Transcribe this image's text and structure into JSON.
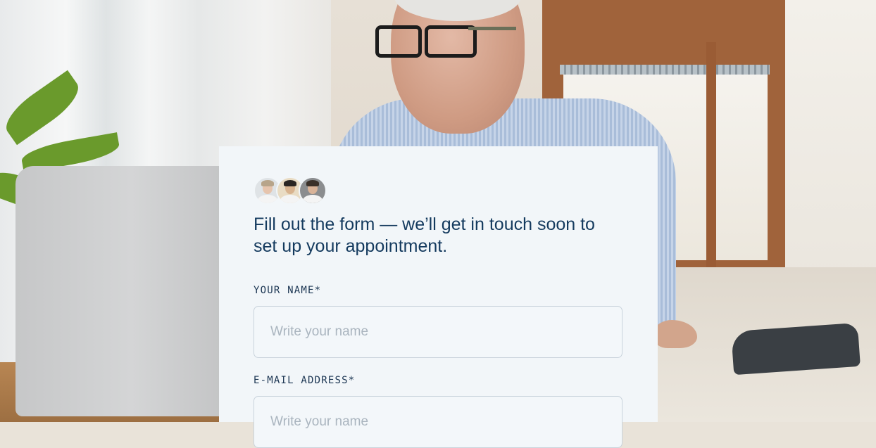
{
  "form": {
    "headline": "Fill out the form — we’ll get in touch soon to set up your appointment.",
    "name_label": "YOUR NAME*",
    "name_placeholder": "Write your name",
    "email_label": "E-MAIL ADDRESS*",
    "email_placeholder": "Write your name"
  },
  "avatars": [
    {
      "name": "doctor-avatar-1",
      "hair": "#b7a48a",
      "skin": "#e6c4ad"
    },
    {
      "name": "doctor-avatar-2",
      "hair": "#2a2522",
      "skin": "#d8b38f"
    },
    {
      "name": "doctor-avatar-3",
      "hair": "#3a3029",
      "skin": "#d9b398"
    }
  ],
  "colors": {
    "card_background": "#f2f6f9",
    "headline": "#143a5e",
    "label": "#1b3552",
    "field_border": "#c9d3dc",
    "placeholder": "#aab5bf"
  }
}
